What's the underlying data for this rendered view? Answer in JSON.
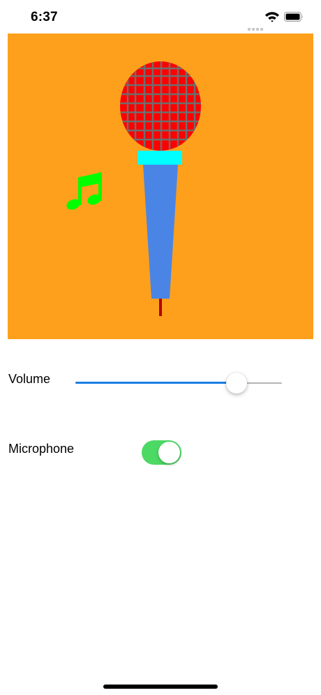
{
  "status_bar": {
    "time": "6:37",
    "icons": [
      "signal-icon",
      "wifi-icon",
      "battery-icon"
    ]
  },
  "artwork": {
    "background_color": "#ffa01c",
    "microphone": {
      "head_color": "#ff0000",
      "grille_color": "#6e6e6e",
      "collar_color": "#00ffff",
      "handle_color": "#4a85e6",
      "cable_color": "#b30000"
    },
    "music_note": {
      "icon": "music-note-icon",
      "color": "#00ff00"
    }
  },
  "controls": {
    "volume": {
      "label": "Volume",
      "value": 0.78,
      "track_color": "#b5b5b8",
      "fill_color": "#1a7ee6"
    },
    "microphone": {
      "label": "Microphone",
      "on": true,
      "on_color": "#4cd964"
    }
  }
}
